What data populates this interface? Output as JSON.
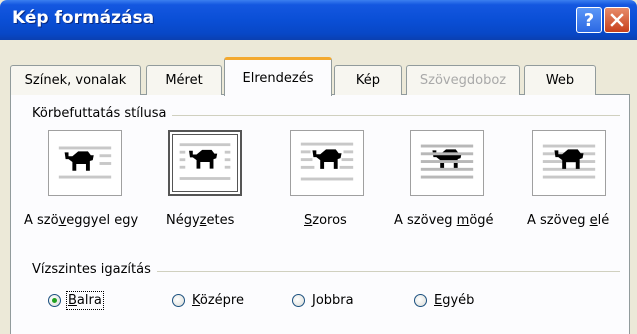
{
  "window": {
    "title": "Kép formázása",
    "help_button": "?",
    "close_icon": "close-icon"
  },
  "tabs": [
    {
      "label": "Színek, vonalak",
      "state": "normal"
    },
    {
      "label": "Méret",
      "state": "normal"
    },
    {
      "label": "Elrendezés",
      "state": "active"
    },
    {
      "label": "Kép",
      "state": "normal"
    },
    {
      "label": "Szövegdoboz",
      "state": "disabled"
    },
    {
      "label": "Web",
      "state": "normal"
    }
  ],
  "wrap_group": {
    "title": "Körbefuttatás stílusa",
    "options": [
      {
        "label_pre": "A szö",
        "label_u": "v",
        "label_post": "eggyel egy",
        "icon": "inline-with-text-icon"
      },
      {
        "label_pre": "Négy",
        "label_u": "z",
        "label_post": "etes",
        "icon": "square-wrap-icon",
        "selected": true
      },
      {
        "label_pre": "",
        "label_u": "S",
        "label_post": "zoros",
        "icon": "tight-wrap-icon"
      },
      {
        "label_pre": "A szöveg ",
        "label_u": "m",
        "label_post": "ögé",
        "icon": "behind-text-icon"
      },
      {
        "label_pre": "A szöveg ",
        "label_u": "e",
        "label_post": "lé",
        "icon": "in-front-of-text-icon"
      }
    ]
  },
  "align_group": {
    "title": "Vízszintes igazítás",
    "options": [
      {
        "label_pre": "",
        "label_u": "B",
        "label_post": "alra",
        "checked": true
      },
      {
        "label_pre": "",
        "label_u": "K",
        "label_post": "özépre",
        "checked": false
      },
      {
        "label_pre": "",
        "label_u": "J",
        "label_post": "obbra",
        "checked": false
      },
      {
        "label_pre": "",
        "label_u": "E",
        "label_post": "gyéb",
        "checked": false
      }
    ]
  },
  "colors": {
    "titlebar": "#0a4fd6",
    "dialog_bg": "#ece9d8",
    "active_tab_accent": "#f3a92f",
    "radio_checked": "#21a121"
  }
}
